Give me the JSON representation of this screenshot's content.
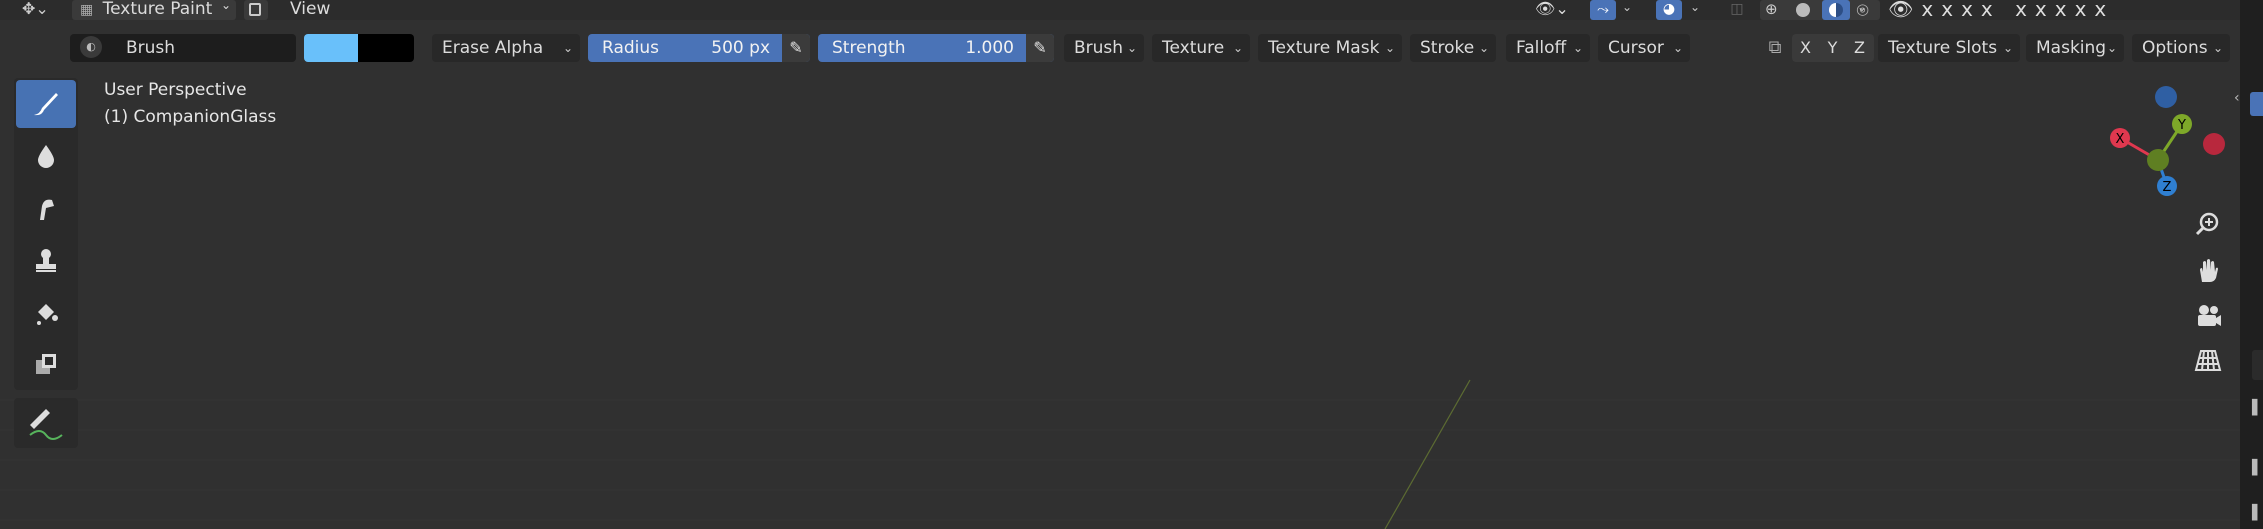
{
  "top_bar": {
    "mode": "Texture Paint",
    "view_menu": "View"
  },
  "tool_header": {
    "brush_name": "Brush",
    "blend_mode": "Erase Alpha",
    "radius": {
      "label": "Radius",
      "value": "500 px"
    },
    "strength": {
      "label": "Strength",
      "value": "1.000"
    },
    "menus": [
      "Brush",
      "Texture",
      "Texture Mask",
      "Stroke",
      "Falloff",
      "Cursor"
    ],
    "axes": [
      "X",
      "Y",
      "Z"
    ],
    "right_menus": [
      "Texture Slots",
      "Masking",
      "Options"
    ],
    "primary_color": "#69c0fa",
    "secondary_color": "#000000"
  },
  "viewport_overlay": {
    "view_name": "User Perspective",
    "object_name": "(1) CompanionGlass"
  },
  "gizmo": {
    "x_label": "X",
    "y_label": "Y",
    "z_label": "Z",
    "x_color": "#e0384f",
    "y_color": "#7ea829",
    "z_color": "#2f7fd1"
  },
  "toolbar": {
    "tools": [
      "draw-brush",
      "soften",
      "smear",
      "clone",
      "fill",
      "mask",
      "annotate"
    ]
  },
  "colors": {
    "accent": "#4772b3",
    "viewport_bg": "#303030"
  }
}
